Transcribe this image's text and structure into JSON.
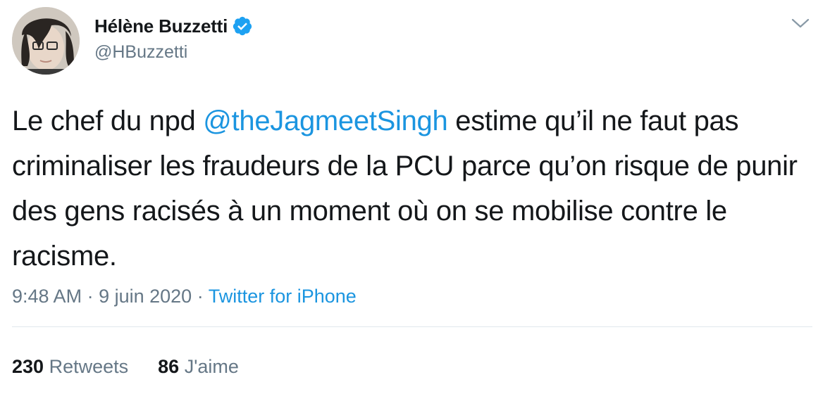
{
  "author": {
    "display_name": "Hélène Buzzetti",
    "handle": "@HBuzzetti",
    "verified": true,
    "verified_icon": "verified-badge-icon",
    "avatar_icon": "profile-photo"
  },
  "menu_icon": "chevron-down-icon",
  "tweet": {
    "text_part1": "Le chef du npd ",
    "mention": "@theJagmeetSingh",
    "text_part2": " estime qu’il ne faut pas criminaliser les fraudeurs de la PCU parce qu’on risque de punir des gens racisés à un moment où on se mobilise contre le racisme."
  },
  "meta": {
    "time": "9:48 AM",
    "sep1": " · ",
    "date": "9 juin 2020",
    "sep2": " · ",
    "source": "Twitter for iPhone"
  },
  "stats": {
    "retweets_count": "230",
    "retweets_label": "Retweets",
    "likes_count": "86",
    "likes_label": "J'aime"
  },
  "colors": {
    "link": "#1b95e0",
    "text": "#14171a",
    "secondary": "#657786",
    "divider": "#e1e8ed"
  }
}
